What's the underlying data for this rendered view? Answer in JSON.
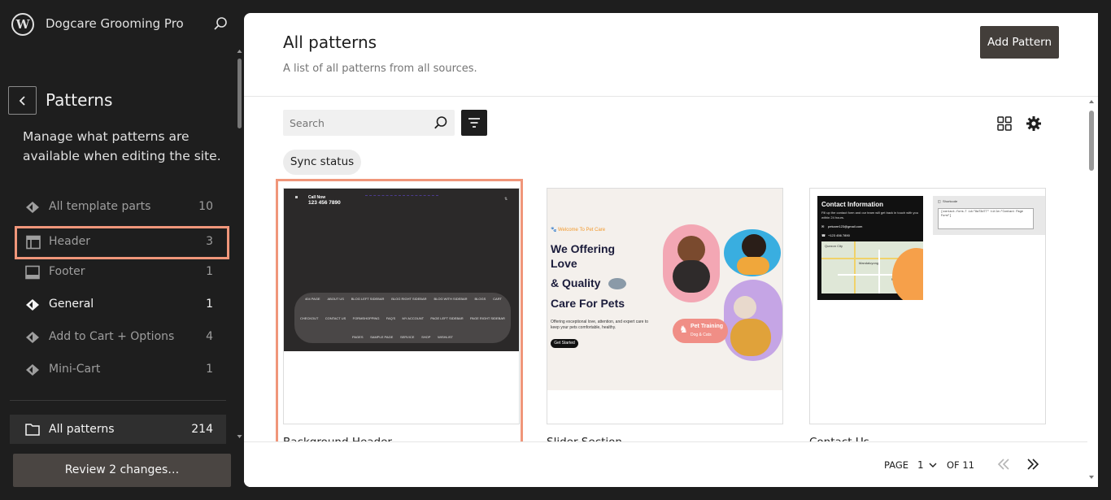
{
  "app": {
    "logo_letter": "W",
    "site_title": "Dogcare Grooming Pro"
  },
  "sidebar": {
    "title": "Patterns",
    "description": "Manage what patterns are available when editing the site.",
    "items": [
      {
        "label": "All template parts",
        "count": "10",
        "icon": "template-part-icon"
      },
      {
        "label": "Header",
        "count": "3",
        "icon": "header-icon"
      },
      {
        "label": "Footer",
        "count": "1",
        "icon": "footer-icon"
      },
      {
        "label": "General",
        "count": "1",
        "icon": "symbol-icon"
      },
      {
        "label": "Add to Cart + Options",
        "count": "4",
        "icon": "symbol-icon"
      },
      {
        "label": "Mini-Cart",
        "count": "1",
        "icon": "symbol-icon"
      }
    ],
    "all_patterns": {
      "label": "All patterns",
      "count": "214"
    },
    "review_button": "Review 2 changes…"
  },
  "main": {
    "title": "All patterns",
    "subtitle": "A list of all patterns from all sources.",
    "add_button": "Add Pattern",
    "search": {
      "placeholder": "Search",
      "value": ""
    },
    "sync_chip": "Sync status",
    "cards": [
      {
        "title": "Background Header"
      },
      {
        "title": "Slider Section"
      },
      {
        "title": "Contact Us"
      }
    ],
    "pagination": {
      "page_label": "PAGE",
      "current": "1",
      "of_label": "OF 11"
    }
  },
  "previews": {
    "header": {
      "call_label": "Call Now",
      "phone": "123 456 7890",
      "menu_row1": [
        "404 PAGE",
        "ABOUT US",
        "BLOG LEFT SIDEBAR",
        "BLOG RIGHT SIDEBAR",
        "BLOG WITH SIDEBAR",
        "BLOGS",
        "CART"
      ],
      "menu_row2": [
        "CHECKOUT",
        "CONTACT US",
        "FORMSHOPPING",
        "FAQ'S",
        "MY ACCOUNT",
        "PAGE LEFT SIDEBAR",
        "PAGE RIGHT SIDEBAR"
      ],
      "menu_row3": [
        "PAGES",
        "SAMPLE PAGE",
        "SERVICE",
        "SHOP",
        "WISHLIST"
      ]
    },
    "slider": {
      "welcome": "Welcome To Pet Care",
      "heading_1": "We Offering",
      "heading_2": "Love",
      "heading_3": "& Quality",
      "heading_4": "Care For Pets",
      "body": "Offering exceptional love, attention, and expert care to keep your pets comfortable, healthy.",
      "cta": "Get Started",
      "badge_title": "Pet Training",
      "badge_sub": "Dog & Cats"
    },
    "contact": {
      "heading": "Contact Information",
      "body": "Fill up the contact form and our team will get back in touch with you within 24 hours.",
      "email": "petcare123@gmail.com",
      "phone": "+123 456 7890",
      "shortcode_label": "Shortcode",
      "shortcode": "[contact-form-7 id=\"8a73d77\" title=\"Contact Page Form\"]",
      "map_labels": [
        "Quezon City",
        "Mandaluyong",
        "Manila"
      ]
    }
  },
  "colors": {
    "accent_outline": "#f0967a",
    "sidebar_bg": "#1e1e1e",
    "button_dark": "#433e3a"
  }
}
